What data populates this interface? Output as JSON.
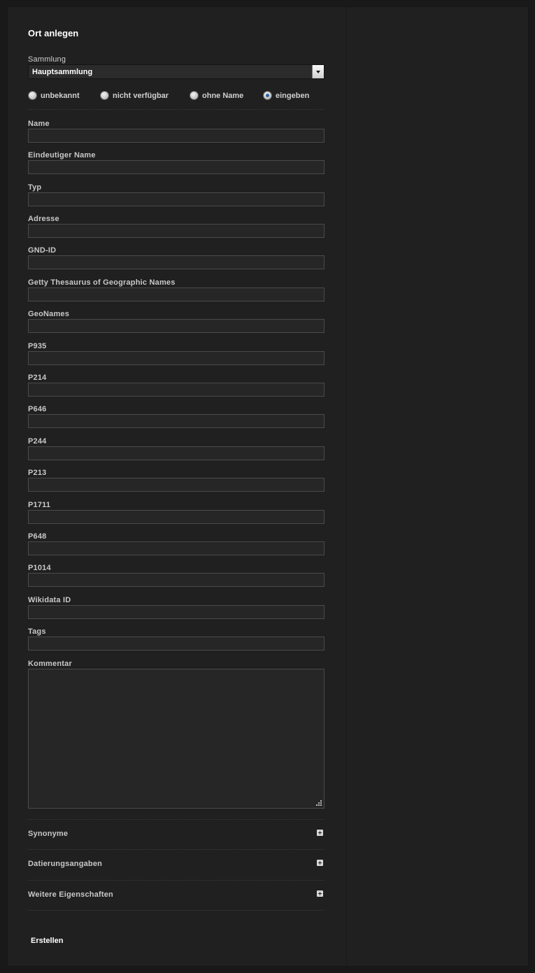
{
  "form": {
    "title": "Ort anlegen",
    "collection_label": "Sammlung",
    "collection_value": "Hauptsammlung",
    "radios": [
      {
        "label": "unbekannt",
        "checked": false
      },
      {
        "label": "nicht verfügbar",
        "checked": false
      },
      {
        "label": "ohne Name",
        "checked": false
      },
      {
        "label": "eingeben",
        "checked": true
      }
    ],
    "fields": {
      "name": "Name",
      "unique_name": "Eindeutiger Name",
      "type": "Typ",
      "address": "Adresse",
      "gnd": "GND-ID",
      "getty": "Getty Thesaurus of Geographic Names",
      "geonames": "GeoNames",
      "p935": "P935",
      "p214": "P214",
      "p646": "P646",
      "p244": "P244",
      "p213": "P213",
      "p1711": "P1711",
      "p648": "P648",
      "p1014": "P1014",
      "wikidata": "Wikidata ID",
      "tags": "Tags",
      "comment": "Kommentar"
    },
    "sections": {
      "synonyms": "Synonyme",
      "dating": "Datierungsangaben",
      "more": "Weitere Eigenschaften"
    },
    "submit_label": "Erstellen"
  }
}
